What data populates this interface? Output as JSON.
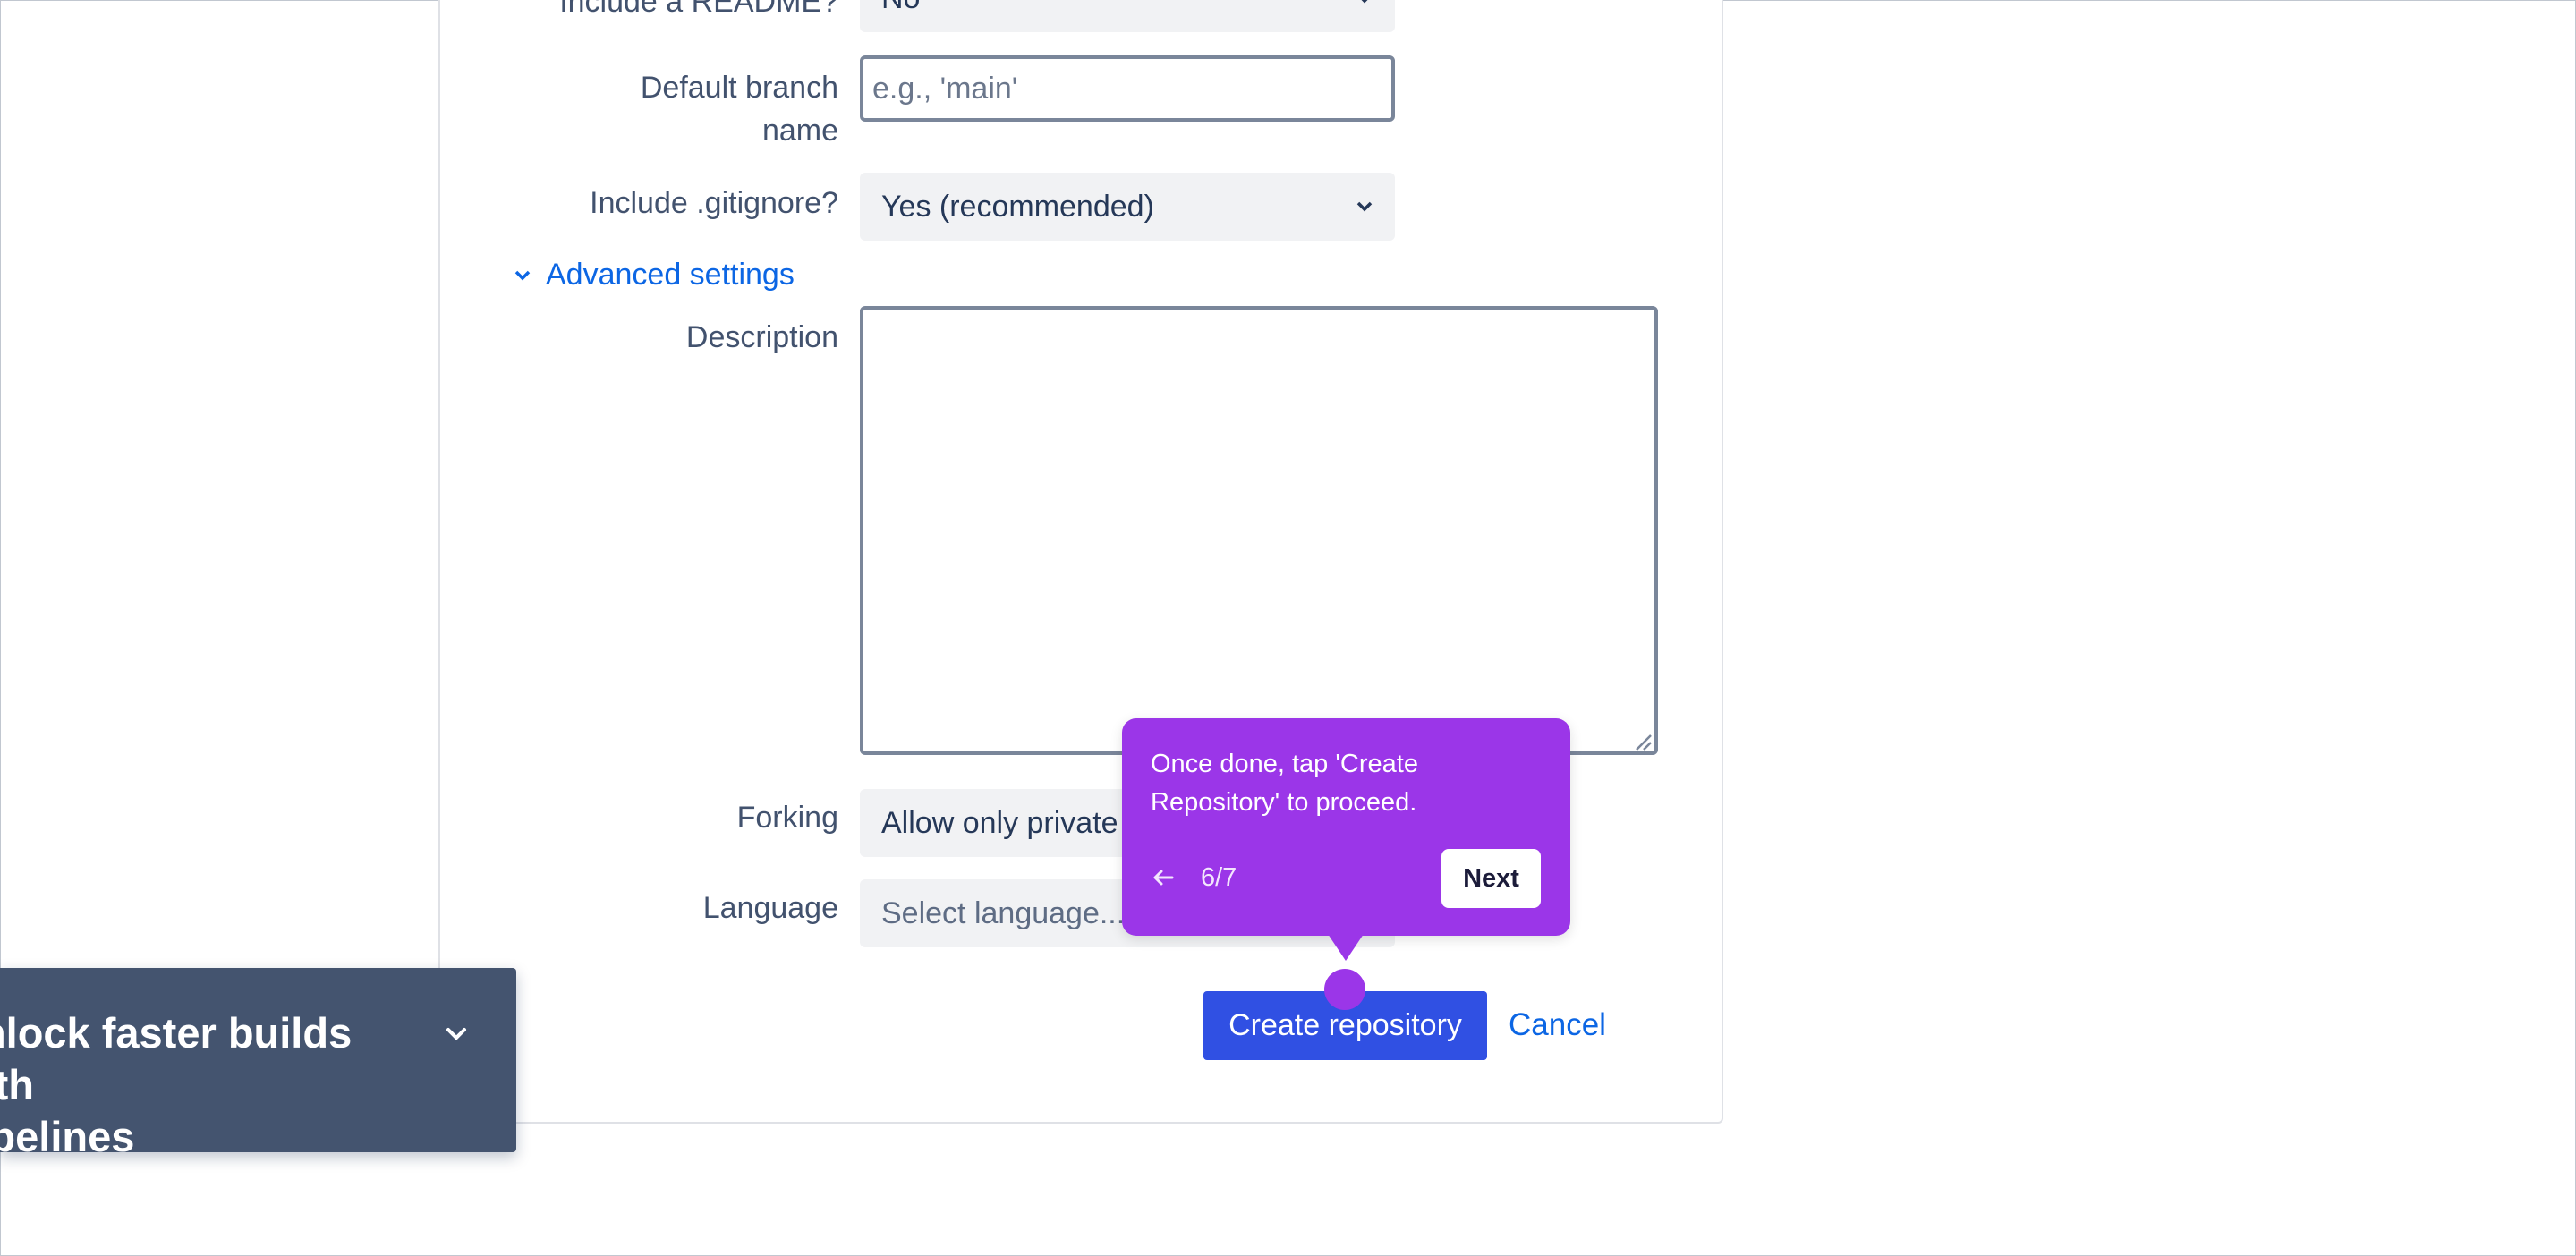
{
  "form": {
    "readme_label": "Include a README?",
    "readme_value": "No",
    "branch_label_line1": "Default branch",
    "branch_label_line2": "name",
    "branch_placeholder": "e.g., 'main'",
    "gitignore_label": "Include .gitignore?",
    "gitignore_value": "Yes (recommended)",
    "advanced_label": "Advanced settings",
    "description_label": "Description",
    "forking_label": "Forking",
    "forking_value": "Allow only private",
    "language_label": "Language",
    "language_value": "Select language...",
    "create_button": "Create repository",
    "cancel_link": "Cancel"
  },
  "tour": {
    "text": "Once done, tap 'Create Repository' to proceed.",
    "step": "6/7",
    "next_label": "Next"
  },
  "promo": {
    "text_line1": "Unlock faster builds with",
    "text_line2": "Pipelines"
  },
  "icons": {
    "select_chevron": "chevron-down-icon",
    "advanced_toggle": "chevron-down-icon",
    "tour_back": "arrow-left-icon",
    "promo_toggle": "chevron-down-icon",
    "textarea_resize": "resize-handle-icon"
  },
  "colors": {
    "primary_button": "#3050e3",
    "link": "#0c66e4",
    "tour_background": "#9b36e8",
    "promo_background": "#44546f"
  }
}
